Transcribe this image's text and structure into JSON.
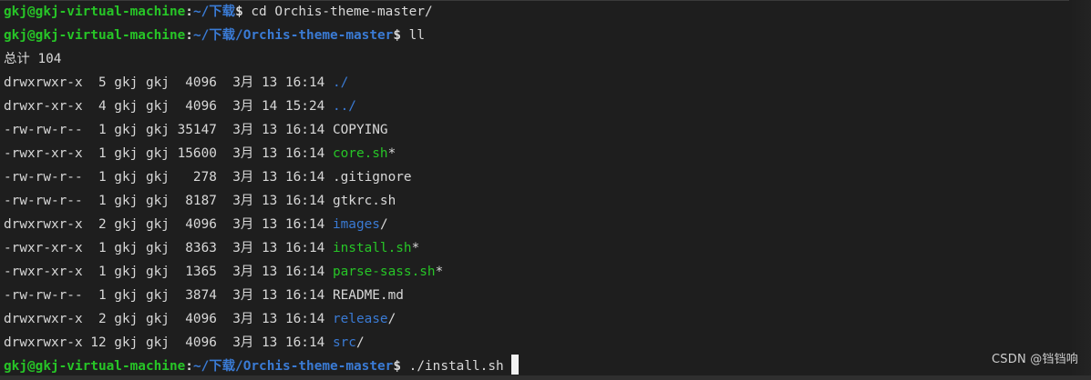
{
  "prompt": {
    "user_host": "gkj@gkj-virtual-machine",
    "colon": ":",
    "dollar": "$"
  },
  "lines": [
    {
      "path": "~/下载",
      "command": " cd Orchis-theme-master/"
    },
    {
      "path": "~/下载/Orchis-theme-master",
      "command": " ll"
    },
    {
      "text": "总计 104"
    }
  ],
  "listing": [
    {
      "meta": "drwxrwxr-x  5 gkj gkj  4096  3月 13 16:14 ",
      "name": "./",
      "kind": "dir",
      "mark": ""
    },
    {
      "meta": "drwxr-xr-x  4 gkj gkj  4096  3月 14 15:24 ",
      "name": "../",
      "kind": "dir",
      "mark": ""
    },
    {
      "meta": "-rw-rw-r--  1 gkj gkj 35147  3月 13 16:14 ",
      "name": "COPYING",
      "kind": "file",
      "mark": ""
    },
    {
      "meta": "-rwxr-xr-x  1 gkj gkj 15600  3月 13 16:14 ",
      "name": "core.sh",
      "kind": "exe",
      "mark": "*"
    },
    {
      "meta": "-rw-rw-r--  1 gkj gkj   278  3月 13 16:14 ",
      "name": ".gitignore",
      "kind": "file",
      "mark": ""
    },
    {
      "meta": "-rw-rw-r--  1 gkj gkj  8187  3月 13 16:14 ",
      "name": "gtkrc.sh",
      "kind": "file",
      "mark": ""
    },
    {
      "meta": "drwxrwxr-x  2 gkj gkj  4096  3月 13 16:14 ",
      "name": "images",
      "kind": "dir",
      "mark": "/"
    },
    {
      "meta": "-rwxr-xr-x  1 gkj gkj  8363  3月 13 16:14 ",
      "name": "install.sh",
      "kind": "exe",
      "mark": "*"
    },
    {
      "meta": "-rwxr-xr-x  1 gkj gkj  1365  3月 13 16:14 ",
      "name": "parse-sass.sh",
      "kind": "exe",
      "mark": "*"
    },
    {
      "meta": "-rw-rw-r--  1 gkj gkj  3874  3月 13 16:14 ",
      "name": "README.md",
      "kind": "file",
      "mark": ""
    },
    {
      "meta": "drwxrwxr-x  2 gkj gkj  4096  3月 13 16:14 ",
      "name": "release",
      "kind": "dir",
      "mark": "/"
    },
    {
      "meta": "drwxrwxr-x 12 gkj gkj  4096  3月 13 16:14 ",
      "name": "src",
      "kind": "dir",
      "mark": "/"
    }
  ],
  "final_prompt": {
    "path": "~/下载/Orchis-theme-master",
    "command": " ./install.sh"
  },
  "watermark": "CSDN @铛铛响",
  "colors": {
    "background": "#1e1e1e",
    "prompt_user": "#27c527",
    "prompt_path": "#3a7bd5",
    "dir": "#3a7bd5",
    "exe": "#27c527",
    "text": "#d8d8d8"
  }
}
